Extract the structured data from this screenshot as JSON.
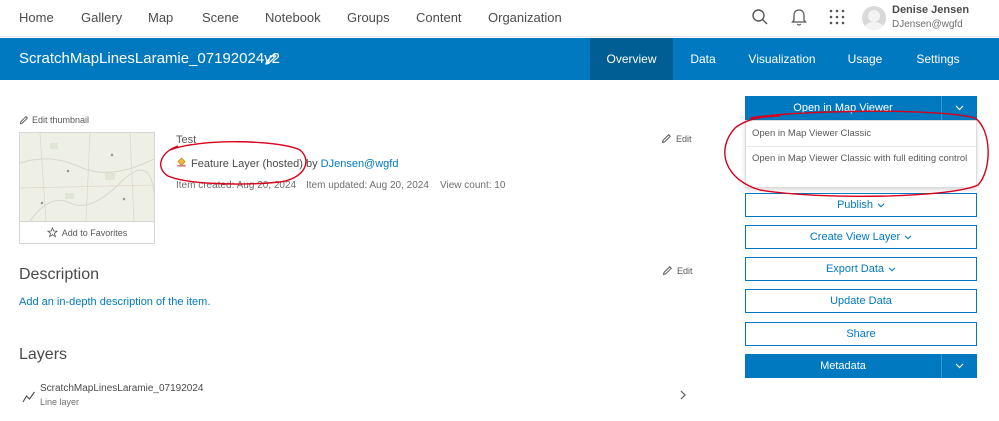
{
  "nav": {
    "items": [
      "Home",
      "Gallery",
      "Map",
      "Scene",
      "Notebook",
      "Groups",
      "Content",
      "Organization"
    ],
    "user_name": "Denise Jensen",
    "user_id": "DJensen@wgfd"
  },
  "header": {
    "title": "ScratchMapLinesLaramie_07192024v2",
    "tabs": [
      "Overview",
      "Data",
      "Visualization",
      "Usage",
      "Settings"
    ],
    "active_tab": "Overview"
  },
  "item": {
    "edit_thumbnail": "Edit thumbnail",
    "add_favorites": "Add to Favorites",
    "title": "Test",
    "type": "Feature Layer (hosted)",
    "by": "by",
    "owner": "DJensen@wgfd",
    "created": "Item created: Aug 20, 2024",
    "updated": "Item updated: Aug 20, 2024",
    "views": "View count: 10",
    "edit": "Edit"
  },
  "description": {
    "heading": "Description",
    "add_link": "Add an in-depth description of the item.",
    "edit": "Edit"
  },
  "layers": {
    "heading": "Layers",
    "items": [
      {
        "name": "ScratchMapLinesLaramie_07192024",
        "type": "Line layer"
      }
    ]
  },
  "actions": {
    "open_map_viewer": "Open in Map Viewer",
    "dropdown": [
      "Open in Map Viewer Classic",
      "Open in Map Viewer Classic with full editing control"
    ],
    "publish": "Publish",
    "create_view": "Create View Layer",
    "export": "Export Data",
    "update": "Update Data",
    "share": "Share",
    "metadata": "Metadata"
  },
  "colors": {
    "brand_blue": "#0079c1",
    "active_tab": "#005e95",
    "annotation_red": "#d7001a"
  }
}
